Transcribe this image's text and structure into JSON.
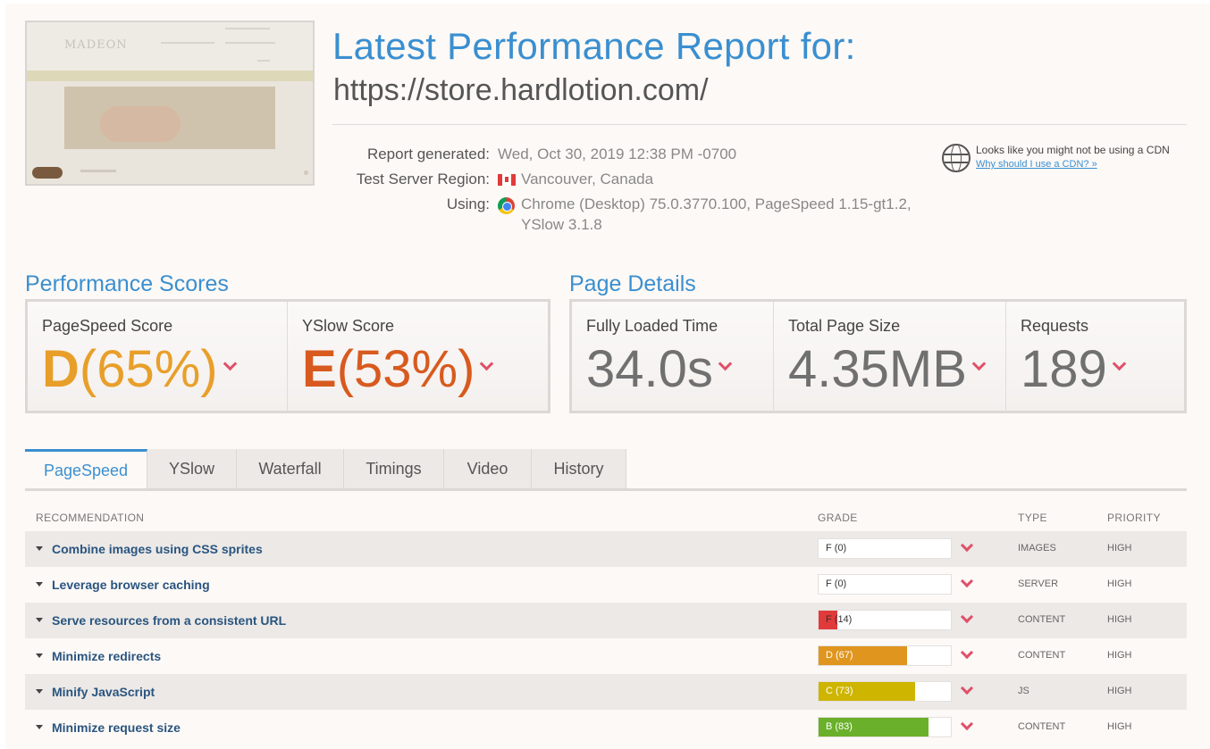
{
  "header": {
    "title": "Latest Performance Report for:",
    "url": "https://store.hardlotion.com/"
  },
  "meta": {
    "generated_label": "Report generated:",
    "generated_value": "Wed, Oct 30, 2019 12:38 PM -0700",
    "region_label": "Test Server Region:",
    "region_value": "Vancouver, Canada",
    "using_label": "Using:",
    "using_value_line1": "Chrome (Desktop) 75.0.3770.100, PageSpeed 1.15-gt1.2,",
    "using_value_line2": "YSlow 3.1.8"
  },
  "cdn": {
    "text": "Looks like you might not be using a CDN",
    "link": "Why should I use a CDN? »"
  },
  "performance_scores": {
    "title": "Performance Scores",
    "pagespeed_label": "PageSpeed Score",
    "pagespeed_grade": "D",
    "pagespeed_pct": "(65%)",
    "yslow_label": "YSlow Score",
    "yslow_grade": "E",
    "yslow_pct": "(53%)"
  },
  "page_details": {
    "title": "Page Details",
    "load_label": "Fully Loaded Time",
    "load_value": "34.0s",
    "size_label": "Total Page Size",
    "size_value": "4.35MB",
    "requests_label": "Requests",
    "requests_value": "189"
  },
  "tabs": [
    "PageSpeed",
    "YSlow",
    "Waterfall",
    "Timings",
    "Video",
    "History"
  ],
  "table": {
    "headers": {
      "recommendation": "RECOMMENDATION",
      "grade": "GRADE",
      "type": "TYPE",
      "priority": "PRIORITY"
    },
    "rows": [
      {
        "rec": "Combine images using CSS sprites",
        "grade": "F (0)",
        "score": 0,
        "color": "#e03a3a",
        "type": "IMAGES",
        "priority": "HIGH"
      },
      {
        "rec": "Leverage browser caching",
        "grade": "F (0)",
        "score": 0,
        "color": "#e03a3a",
        "type": "SERVER",
        "priority": "HIGH"
      },
      {
        "rec": "Serve resources from a consistent URL",
        "grade": "F (14)",
        "score": 14,
        "color": "#e03a3a",
        "type": "CONTENT",
        "priority": "HIGH"
      },
      {
        "rec": "Minimize redirects",
        "grade": "D (67)",
        "score": 67,
        "color": "#e0951f",
        "type": "CONTENT",
        "priority": "HIGH"
      },
      {
        "rec": "Minify JavaScript",
        "grade": "C (73)",
        "score": 73,
        "color": "#cdb500",
        "type": "JS",
        "priority": "HIGH"
      },
      {
        "rec": "Minimize request size",
        "grade": "B (83)",
        "score": 83,
        "color": "#6ab02a",
        "type": "CONTENT",
        "priority": "HIGH"
      }
    ]
  }
}
